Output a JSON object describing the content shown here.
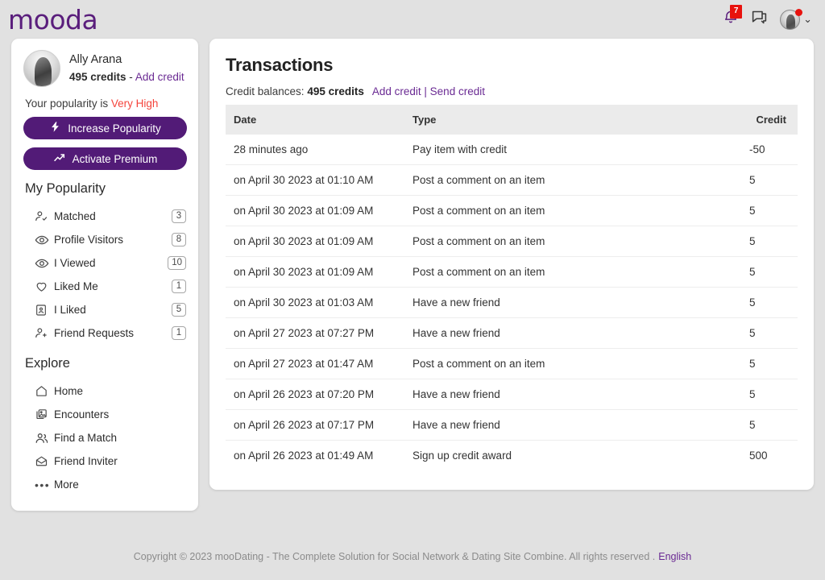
{
  "brand": "mooda",
  "topbar": {
    "notifications_icon": "bell-icon",
    "notifications_count": "7",
    "messages_icon": "chat-icon",
    "account_chevron": "⌄"
  },
  "sidebar": {
    "profile": {
      "name": "Ally Arana",
      "credits": "495 credits",
      "dash": " - ",
      "add_credit_label": "Add credit",
      "popularity_prefix": "Your popularity is ",
      "popularity_value": "Very High",
      "popularity_color": "#f4433b"
    },
    "buttons": [
      {
        "label": "Increase Popularity",
        "icon": "bolt-icon"
      },
      {
        "label": "Activate Premium",
        "icon": "trending-up-icon"
      }
    ],
    "popularity_section": {
      "title": "My Popularity",
      "items": [
        {
          "label": "Matched",
          "badge": "3",
          "icon": "person-check-icon"
        },
        {
          "label": "Profile Visitors",
          "badge": "8",
          "icon": "eye-icon"
        },
        {
          "label": "I Viewed",
          "badge": "10",
          "icon": "eye-icon"
        },
        {
          "label": "Liked Me",
          "badge": "1",
          "icon": "heart-icon"
        },
        {
          "label": "I Liked",
          "badge": "5",
          "icon": "portrait-icon"
        },
        {
          "label": "Friend Requests",
          "badge": "1",
          "icon": "person-plus-icon"
        }
      ]
    },
    "explore_section": {
      "title": "Explore",
      "items": [
        {
          "label": "Home",
          "icon": "home-icon"
        },
        {
          "label": "Encounters",
          "icon": "photo-card-icon"
        },
        {
          "label": "Find a Match",
          "icon": "people-icon"
        },
        {
          "label": "Friend Inviter",
          "icon": "envelope-icon"
        },
        {
          "label": "More",
          "icon": "ellipsis-icon"
        }
      ]
    }
  },
  "main": {
    "title": "Transactions",
    "balance_prefix": "Credit balances: ",
    "balance_value": "495 credits",
    "add_credit_label": "Add credit",
    "separator": " | ",
    "send_credit_label": "Send credit",
    "table": {
      "columns": [
        "Date",
        "Type",
        "Credit"
      ],
      "rows": [
        {
          "date": "28 minutes ago",
          "type": "Pay item with credit",
          "credit": "-50"
        },
        {
          "date": "on April 30 2023 at 01:10 AM",
          "type": "Post a comment on an item",
          "credit": "5"
        },
        {
          "date": "on April 30 2023 at 01:09 AM",
          "type": "Post a comment on an item",
          "credit": "5"
        },
        {
          "date": "on April 30 2023 at 01:09 AM",
          "type": "Post a comment on an item",
          "credit": "5"
        },
        {
          "date": "on April 30 2023 at 01:09 AM",
          "type": "Post a comment on an item",
          "credit": "5"
        },
        {
          "date": "on April 30 2023 at 01:03 AM",
          "type": "Have a new friend",
          "credit": "5"
        },
        {
          "date": "on April 27 2023 at 07:27 PM",
          "type": "Have a new friend",
          "credit": "5"
        },
        {
          "date": "on April 27 2023 at 01:47 AM",
          "type": "Post a comment on an item",
          "credit": "5"
        },
        {
          "date": "on April 26 2023 at 07:20 PM",
          "type": "Have a new friend",
          "credit": "5"
        },
        {
          "date": "on April 26 2023 at 07:17 PM",
          "type": "Have a new friend",
          "credit": "5"
        },
        {
          "date": "on April 26 2023 at 01:49 AM",
          "type": "Sign up credit award",
          "credit": "500"
        }
      ]
    }
  },
  "footer": {
    "text": "Copyright © 2023 mooDating - The Complete Solution for Social Network & Dating Site Combine. All rights reserved  .",
    "language": "English"
  },
  "colors": {
    "brand_purple": "#5a1e7c",
    "button_purple": "#521b77",
    "link_purple": "#6a2a93",
    "badge_red": "#e8120e",
    "page_bg": "#e1e1e1"
  }
}
